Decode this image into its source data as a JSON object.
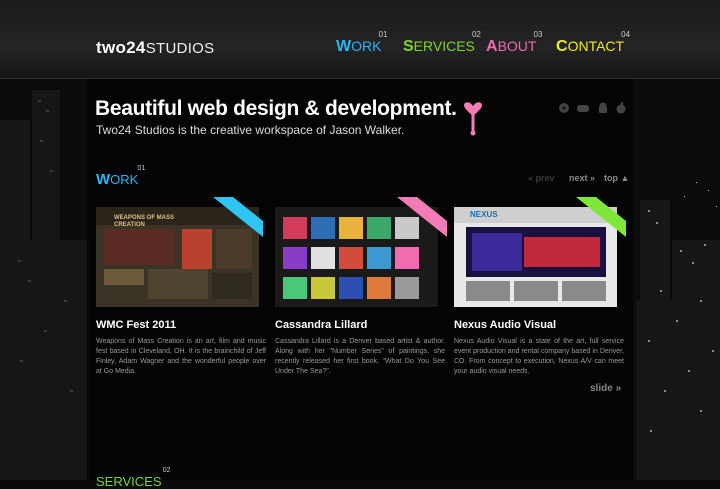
{
  "header": {
    "logo_bold": "two24",
    "logo_light": "STUDIOS",
    "nav": [
      {
        "cap": "W",
        "rest": "ORK",
        "num": "01",
        "color": "#2fb4f2"
      },
      {
        "cap": "S",
        "rest": "ERVICES",
        "num": "02",
        "color": "#7bd62c"
      },
      {
        "cap": "A",
        "rest": "BOUT",
        "num": "03",
        "color": "#f06bb0"
      },
      {
        "cap": "C",
        "rest": "ONTACT",
        "num": "04",
        "color": "#ecec2a"
      }
    ]
  },
  "hero": {
    "title": "Beautiful web design & development.",
    "subtitle": "Two24 Studios is the creative workspace of Jason Walker.",
    "social_icons": [
      "dribbble-icon",
      "gamepad-icon",
      "android-icon",
      "apple-icon"
    ]
  },
  "work": {
    "title_cap": "W",
    "title_rest": "ORK",
    "num": "01",
    "pager": {
      "prev": "« prev",
      "next": "next »",
      "top": "top ▲"
    },
    "slide": "slide »",
    "cards": [
      {
        "title": "WMC Fest 2011",
        "desc": "Weapons of Mass Creation is an art, film and music fest based in Cleveland, OH. It is the brainchild of Jeff Finley, Adam Wagner and the wonderful people over at Go Media.",
        "ribbon_color": "#2fc4f2",
        "thumb_text": "WEAPONS OF MASS CREATION"
      },
      {
        "title": "Cassandra Lillard",
        "desc": "Cassandra Lillard is a Denver based artist & author. Along with her \"Number Series\" of paintings, she recently released her first book, \"What Do You See Under The Sea?\".",
        "ribbon_color": "#f27cb6",
        "thumb_text": ""
      },
      {
        "title": "Nexus Audio Visual",
        "desc": "Nexus Audio Visual is a state of the art, full service event production and rental company based in Denver, CO. From concept to execution, Nexus A/V can meet your audio visual needs.",
        "ribbon_color": "#7de83a",
        "thumb_text": "NEXUS"
      }
    ]
  },
  "services": {
    "label": "SERVICES",
    "num": "02"
  }
}
